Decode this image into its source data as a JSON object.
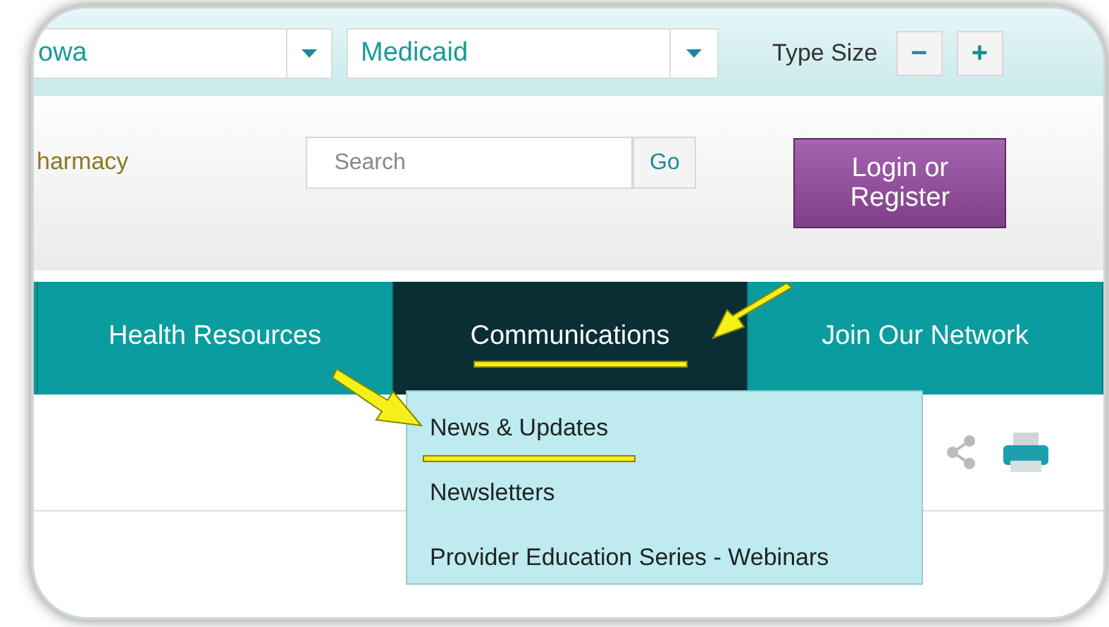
{
  "top_bar": {
    "state_select": {
      "value": "owa"
    },
    "plan_select": {
      "value": "Medicaid"
    },
    "type_size": {
      "label": "Type Size",
      "buttons": [
        "−",
        "+"
      ]
    }
  },
  "header": {
    "link": "harmacy",
    "search": {
      "placeholder": "Search",
      "button": "Go"
    },
    "login_button": "Login or Register"
  },
  "nav": [
    {
      "label": "Health Resources",
      "selected": false
    },
    {
      "label": "Communications",
      "selected": true
    },
    {
      "label": "Join Our Network",
      "selected": false
    }
  ],
  "dropdown": [
    {
      "label": "News & Updates"
    },
    {
      "label": "Newsletters"
    },
    {
      "label": "Provider Education Series - Webinars"
    }
  ]
}
